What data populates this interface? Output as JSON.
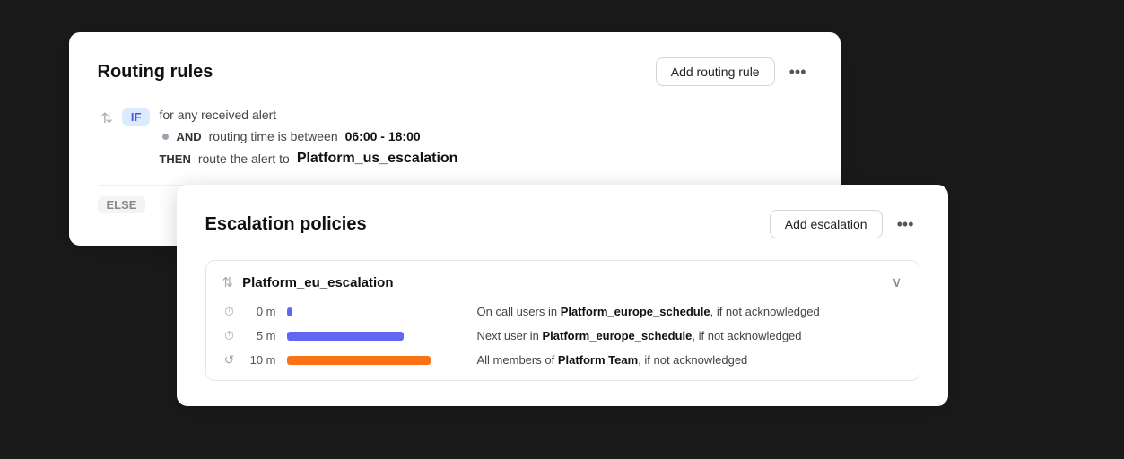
{
  "routing_card": {
    "title": "Routing rules",
    "add_button": "Add routing rule",
    "more_icon": "•••",
    "rule": {
      "if_label": "IF",
      "if_text": "for any received alert",
      "and_label": "AND",
      "and_text": "routing time is between",
      "time_range": "06:00 - 18:00",
      "then_label": "THEN",
      "then_text": "route the alert to",
      "then_target": "Platform_us_escalation"
    },
    "else_label": "ELSE"
  },
  "escalation_card": {
    "title": "Escalation policies",
    "add_button": "Add escalation",
    "more_icon": "•••",
    "policy": {
      "name": "Platform_eu_escalation",
      "rows": [
        {
          "icon": "clock",
          "time": "0 m",
          "bar_class": "bar-tiny",
          "description": "On call users in",
          "bold_part": "Platform_europe_schedule",
          "suffix": ", if not acknowledged"
        },
        {
          "icon": "clock",
          "time": "5 m",
          "bar_class": "bar-med",
          "description": "Next user in",
          "bold_part": "Platform_europe_schedule",
          "suffix": ", if not acknowledged"
        },
        {
          "icon": "refresh",
          "time": "10 m",
          "bar_class": "bar-long",
          "description": "All members of",
          "bold_part": "Platform Team",
          "suffix": ", if not acknowledged"
        }
      ]
    }
  }
}
